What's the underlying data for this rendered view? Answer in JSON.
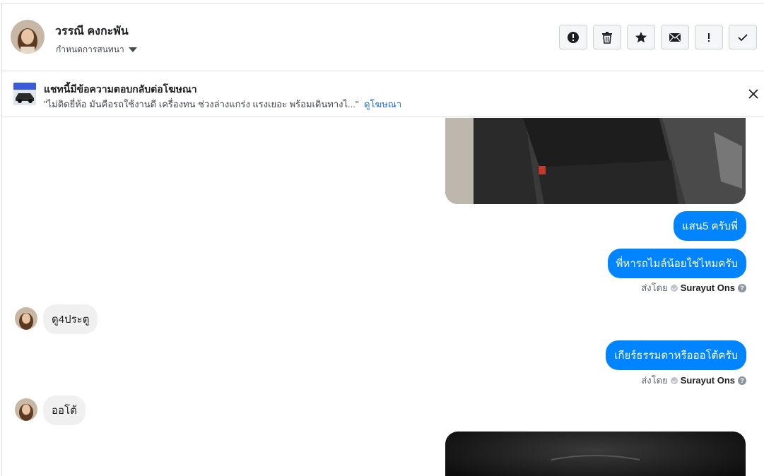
{
  "header": {
    "contact_name": "วรรณี คงกะพัน",
    "conversation_label": "กำหนดการสนทนา",
    "toolbar": [
      {
        "name": "spam-button",
        "icon": "exclamation-circle-icon"
      },
      {
        "name": "delete-button",
        "icon": "trash-icon"
      },
      {
        "name": "star-button",
        "icon": "star-icon"
      },
      {
        "name": "mark-unread-button",
        "icon": "envelope-icon"
      },
      {
        "name": "mark-important-button",
        "icon": "exclamation-icon"
      },
      {
        "name": "mark-done-button",
        "icon": "check-icon"
      }
    ]
  },
  "ad_banner": {
    "title": "แชทนี้มีข้อความตอบกลับต่อโฆษณา",
    "body": "\"ไม่ติดยี่ห้อ มันคือรถใช้งานดี เครื่องทน ช่วงล่างแกร่ง แรงเยอะ พร้อมเดินทางไ...\"",
    "link": "ดูโฆษณา"
  },
  "messages": {
    "m1": "แสน5 ครับพี่",
    "m2": "พี่หารถไมล์น้อยใช่ไหมครับ",
    "m2_sent_by_label": "ส่งโดย",
    "m2_sent_by_name": "Surayut Ons",
    "m3": "ดู4ประตู",
    "m4": "เกียร์ธรรมดาหรือออโต้ครับ",
    "m4_sent_by_label": "ส่งโดย",
    "m4_sent_by_name": "Surayut Ons",
    "m5": "ออโต้"
  },
  "colors": {
    "outgoing_bubble": "#0084ff",
    "incoming_bubble": "#f1f0f0",
    "link": "#216fdb",
    "border": "#dadde1"
  }
}
